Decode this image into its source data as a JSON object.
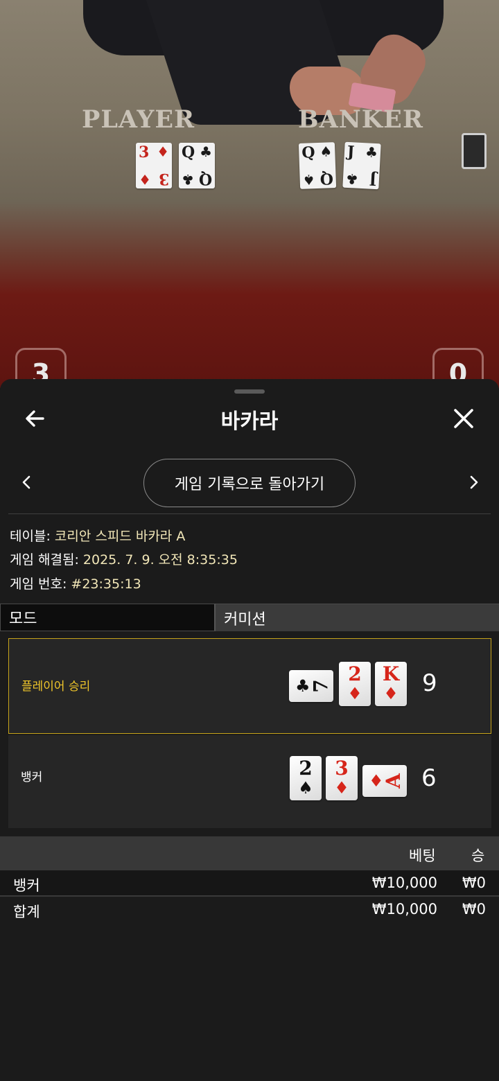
{
  "video": {
    "player_label": "PLAYER",
    "banker_label": "BANKER",
    "player_cards": [
      {
        "rank": "3",
        "suit": "♦",
        "color": "red"
      },
      {
        "rank": "Q",
        "suit": "♣",
        "color": "black"
      }
    ],
    "banker_cards": [
      {
        "rank": "Q",
        "suit": "♠",
        "color": "black"
      },
      {
        "rank": "J",
        "suit": "♣",
        "color": "black"
      }
    ],
    "player_score": "3",
    "banker_score": "0"
  },
  "sheet": {
    "title": "바카라",
    "back_icon": "arrow-left-icon",
    "close_icon": "close-icon",
    "history_button": "게임 기록으로 돌아가기",
    "info": {
      "table_label": "테이블:",
      "table_value": "코리안 스피드 바카라 A",
      "resolved_label": "게임 해결됨:",
      "resolved_value": "2025. 7. 9. 오전 8:35:35",
      "game_no_label": "게임 번호:",
      "game_no_value": "#23:35:13"
    },
    "tabs": [
      "모드",
      "커미션"
    ]
  },
  "results": {
    "player": {
      "label": "플레이어 승리",
      "score": "9",
      "cards": [
        {
          "rank": "7",
          "suit": "♣",
          "color": "black",
          "orientation": "horizontal"
        },
        {
          "rank": "2",
          "suit": "♦",
          "color": "red",
          "orientation": "vertical"
        },
        {
          "rank": "K",
          "suit": "♦",
          "color": "red",
          "orientation": "vertical"
        }
      ]
    },
    "banker": {
      "label": "뱅커",
      "score": "6",
      "cards": [
        {
          "rank": "2",
          "suit": "♠",
          "color": "black",
          "orientation": "vertical"
        },
        {
          "rank": "3",
          "suit": "♦",
          "color": "red",
          "orientation": "vertical"
        },
        {
          "rank": "A",
          "suit": "♦",
          "color": "red",
          "orientation": "horizontal"
        }
      ]
    },
    "winner_color": "#f0c62a"
  },
  "bets": {
    "headers": {
      "bet": "베팅",
      "win": "승"
    },
    "rows": [
      {
        "name": "뱅커",
        "bet": "₩10,000",
        "win": "₩0"
      }
    ],
    "total": {
      "name": "합계",
      "bet": "₩10,000",
      "win": "₩0"
    }
  }
}
